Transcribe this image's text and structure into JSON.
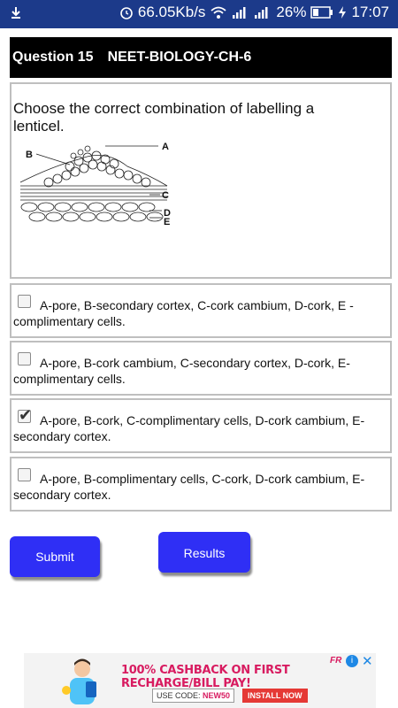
{
  "status_bar": {
    "speed": "66.05Kb/s",
    "battery": "26%",
    "time": "17:07",
    "sim1": "1",
    "sim2": "2"
  },
  "question": {
    "number": "Question 15",
    "chapter": "NEET-BIOLOGY-CH-6",
    "text": "Choose the correct combination of labelling a lenticel.",
    "diagram_labels": [
      "A",
      "B",
      "C",
      "D",
      "E"
    ]
  },
  "options": [
    {
      "label": "A-pore, B-secondary cortex, C-cork cambium, D-cork, E - complimentary cells.",
      "checked": false
    },
    {
      "label": "A-pore, B-cork cambium, C-secondary cortex, D-cork, E-complimentary cells.",
      "checked": false
    },
    {
      "label": "A-pore, B-cork, C-complimentary cells, D-cork cambium, E-secondary cortex.",
      "checked": true
    },
    {
      "label": "A-pore, B-complimentary cells, C-cork, D-cork cambium, E-secondary cortex.",
      "checked": false
    }
  ],
  "buttons": {
    "submit": "Submit",
    "results": "Results"
  },
  "ad": {
    "headline": "100% CASHBACK ON FIRST RECHARGE/BILL PAY!",
    "use_code_label": "USE CODE: ",
    "code": "NEW50",
    "install": "INSTALL NOW",
    "brand": "FR",
    "info": "i",
    "close": "✕"
  },
  "colors": {
    "status_bar": "#1c3a8a",
    "button": "#2f2ff5",
    "header": "#000000"
  }
}
